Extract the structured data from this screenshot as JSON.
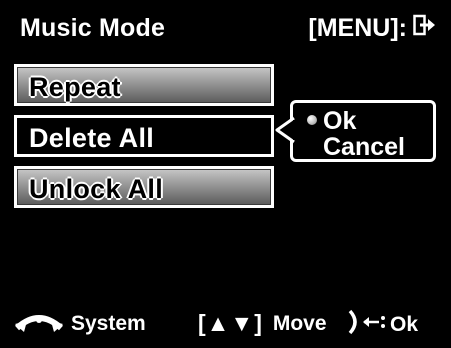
{
  "header": {
    "title": "Music Mode",
    "menu_hint": "[MENU]:"
  },
  "menu": {
    "items": [
      {
        "label": "Repeat",
        "selected": false
      },
      {
        "label": "Delete All",
        "selected": true
      },
      {
        "label": "Unlock All",
        "selected": false
      }
    ]
  },
  "popup": {
    "options": [
      {
        "label": "Ok",
        "selected": true
      },
      {
        "label": "Cancel",
        "selected": false
      }
    ]
  },
  "footer": {
    "system_label": "System",
    "move_keys": "[▲▼]",
    "move_label": "Move",
    "ok_label": "Ok"
  },
  "icons": {
    "exit": "exit-icon",
    "mode_dial": "mode-dial-icon",
    "shutter": "shutter-icon",
    "radio": "radio-dot-icon"
  },
  "colors": {
    "background": "#000000",
    "text": "#ffffff",
    "button_gradient_top": "#c7c7c7",
    "button_gradient_bottom": "#5a5a5a"
  }
}
